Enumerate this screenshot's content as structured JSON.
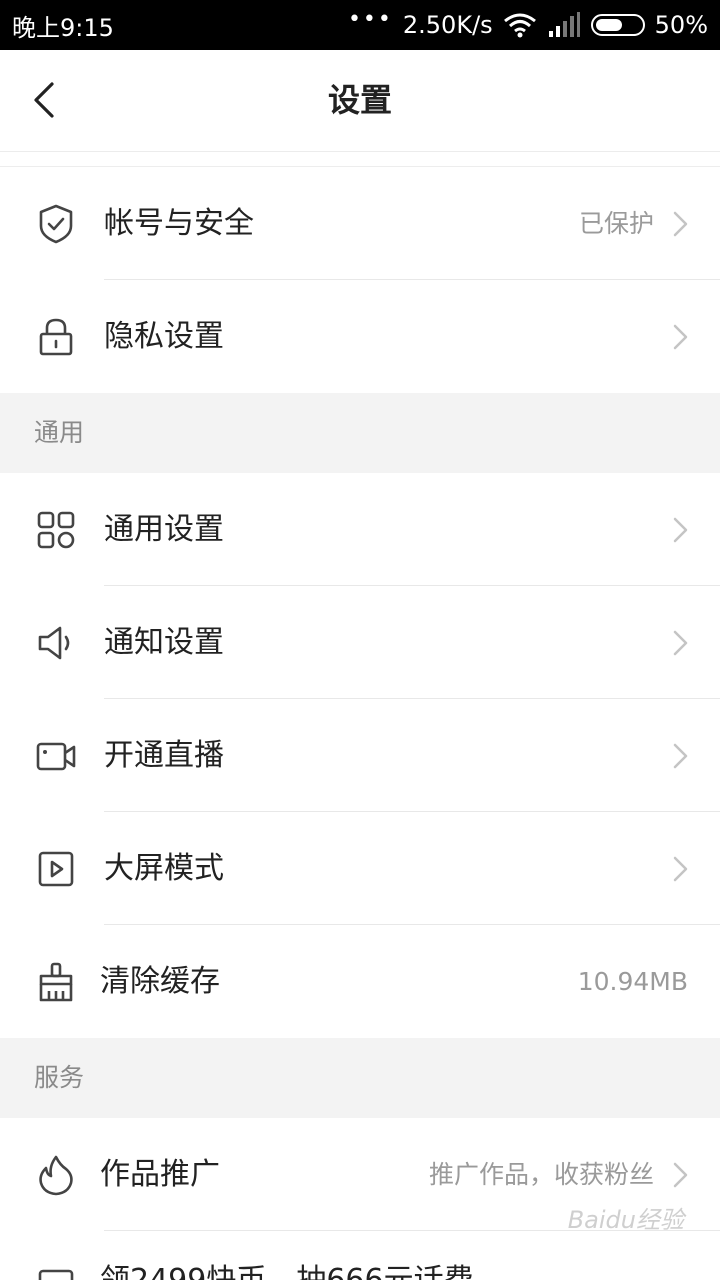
{
  "status_bar": {
    "time": "晚上9:15",
    "dots": "•••",
    "speed": "2.50K/s",
    "battery": "50%"
  },
  "nav": {
    "title": "设置"
  },
  "sections": {
    "general_header": "通用",
    "service_header": "服务"
  },
  "rows": {
    "account": {
      "label": "帐号与安全",
      "value": "已保护",
      "icon": "shield-check-icon"
    },
    "privacy": {
      "label": "隐私设置",
      "icon": "lock-icon"
    },
    "general": {
      "label": "通用设置",
      "icon": "grid-icon"
    },
    "notify": {
      "label": "通知设置",
      "icon": "speaker-icon"
    },
    "live": {
      "label": "开通直播",
      "icon": "video-camera-icon"
    },
    "bigscreen": {
      "label": "大屏模式",
      "icon": "play-square-icon"
    },
    "cache": {
      "label": "清除缓存",
      "value": "10.94MB",
      "icon": "broom-icon"
    },
    "promote": {
      "label": "作品推广",
      "value": "推广作品，收获粉丝",
      "icon": "flame-icon"
    },
    "coupon": {
      "label": "领2499快币，抽666元话费"
    }
  },
  "watermark": "Baidu经验"
}
